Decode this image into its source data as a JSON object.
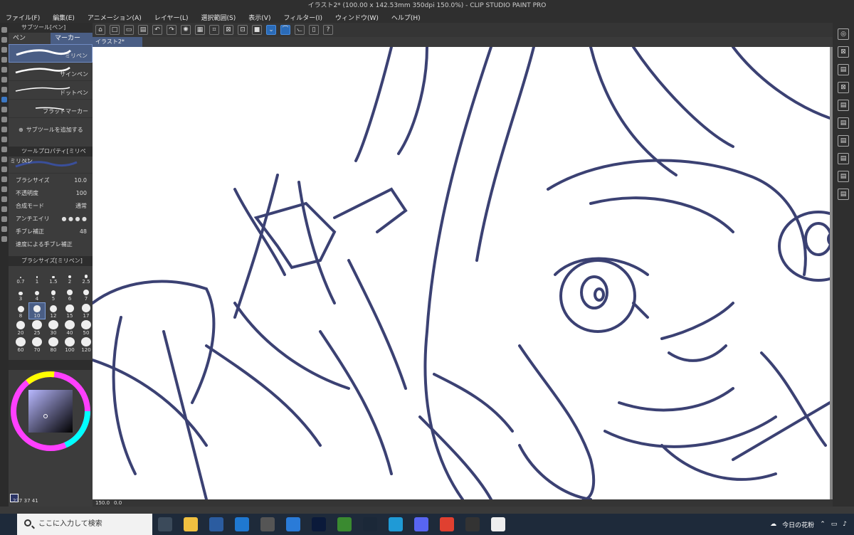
{
  "window": {
    "title": "イラスト2* (100.00 x 142.53mm 350dpi 150.0%) - CLIP STUDIO PAINT PRO"
  },
  "menu": [
    "ファイル(F)",
    "編集(E)",
    "アニメーション(A)",
    "レイヤー(L)",
    "選択範囲(S)",
    "表示(V)",
    "フィルター(I)",
    "ウィンドウ(W)",
    "ヘルプ(H)"
  ],
  "subtool": {
    "panel_title": "サブツール[ペン]",
    "tabs": [
      "ペン",
      "マーカー"
    ],
    "brushes": [
      "ミリペン",
      "サインペン",
      "ドットペン",
      "フラットマーカー"
    ],
    "add_label": "サブツールを追加する"
  },
  "toolprop": {
    "panel_title": "ツールプロパティ[ミリペン]",
    "brush_name": "ミリペン",
    "brush_size_label": "ブラシサイズ",
    "brush_size_value": "10.0",
    "opacity_label": "不透明度",
    "opacity_value": "100",
    "blend_label": "合成モード",
    "blend_value": "通常",
    "antialias_label": "アンチエイリ",
    "stabilize_label": "手ブレ補正",
    "stabilize_value": "48",
    "speed_label": "速度による手ブレ補正"
  },
  "brushsize": {
    "panel_title": "ブラシサイズ[ミリペン]",
    "sizes": [
      "0.7",
      "1",
      "1.5",
      "2",
      "2.5",
      "3",
      "4",
      "5",
      "6",
      "7",
      "8",
      "10",
      "12",
      "15",
      "17",
      "20",
      "25",
      "30",
      "40",
      "50",
      "60",
      "70",
      "80",
      "100",
      "120"
    ],
    "selected": "10"
  },
  "color": {
    "main": "#2c3566",
    "swatch_bottom": "#4b4b8a"
  },
  "status": {
    "zoom": "150.0",
    "angle": "0.0",
    "coords": [
      "237",
      "37",
      "41"
    ]
  },
  "canvas_tab": "イラスト2*",
  "taskbar": {
    "search_placeholder": "ここに入力して検索",
    "weather": "今日の花粉"
  },
  "line_color": "#3b4173"
}
